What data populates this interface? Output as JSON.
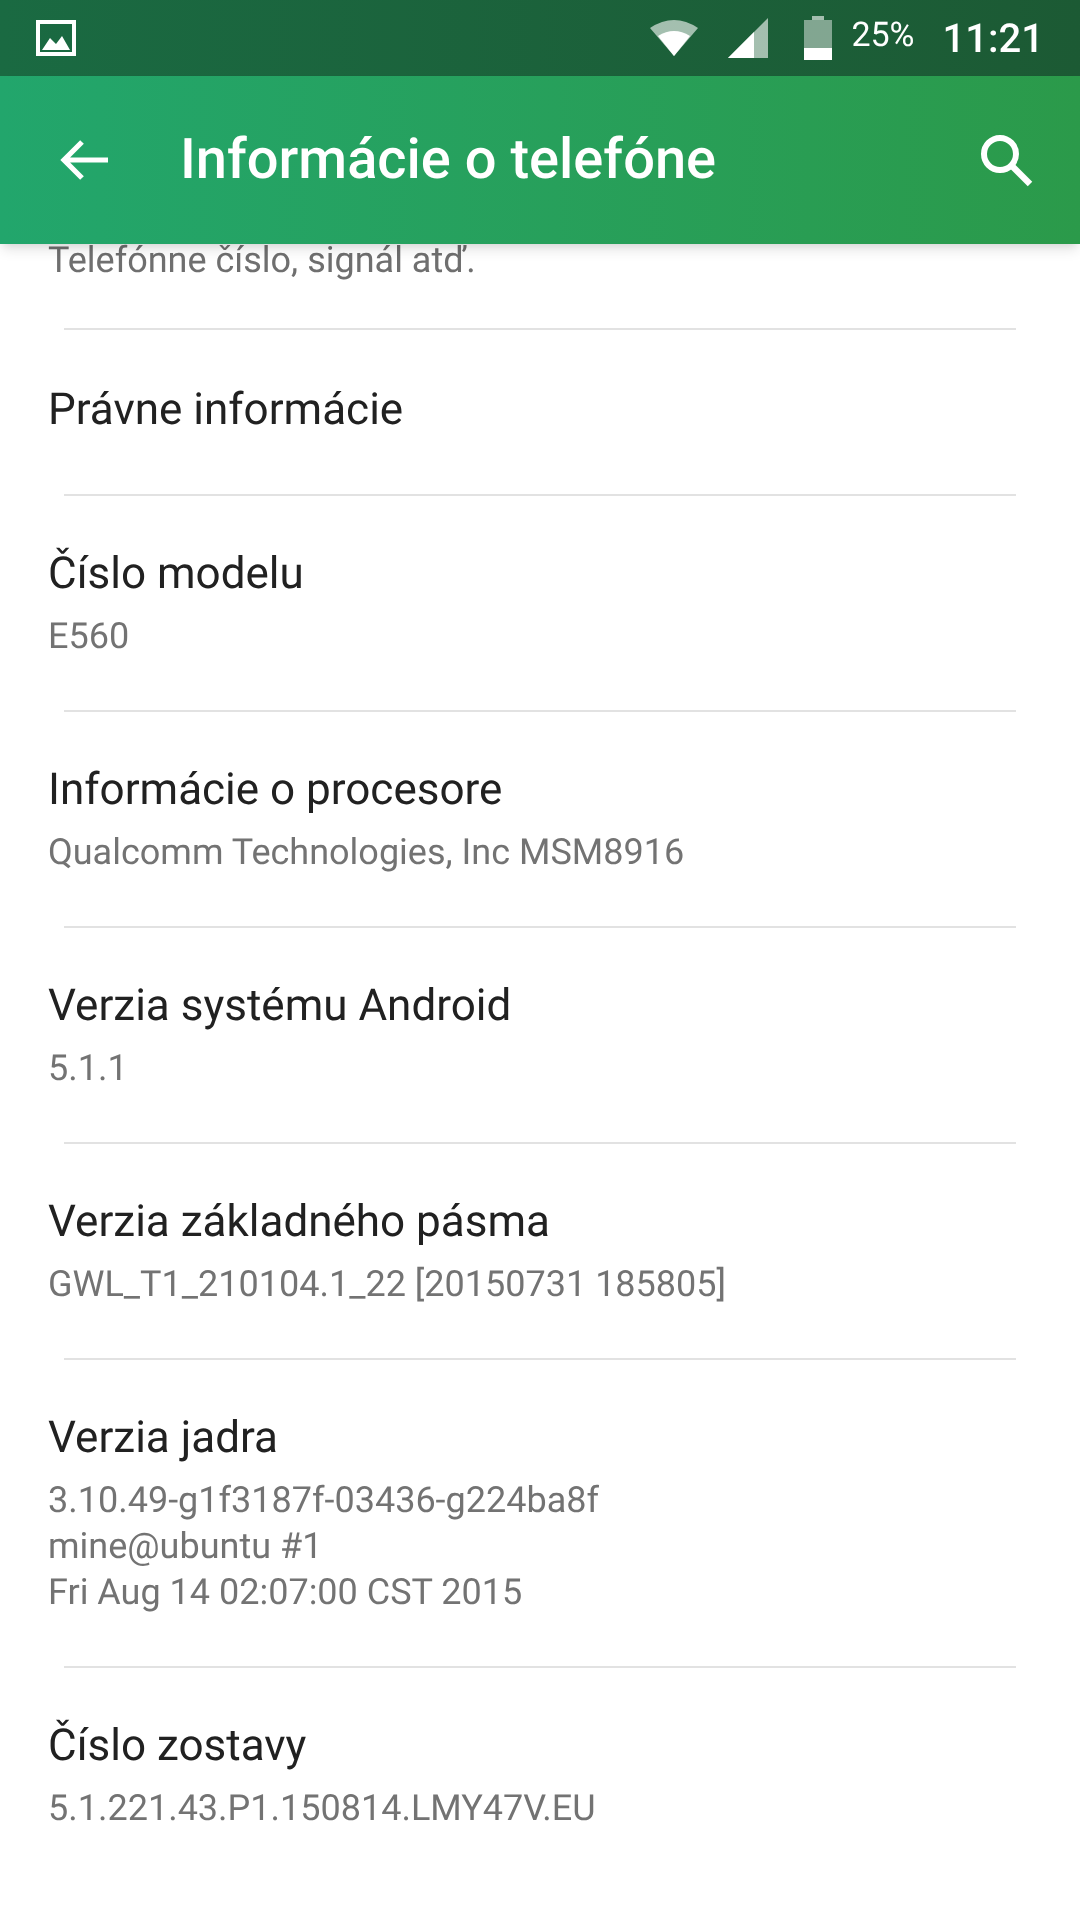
{
  "status_bar": {
    "battery": "25%",
    "time": "11:21"
  },
  "app_bar": {
    "title": "Informácie o telefóne"
  },
  "partial_item": {
    "subtitle": "Telefónne číslo, signál atď."
  },
  "items": [
    {
      "title": "Právne informácie"
    },
    {
      "title": "Číslo modelu",
      "value": "E560"
    },
    {
      "title": "Informácie o procesore",
      "value": "Qualcomm Technologies, Inc MSM8916"
    },
    {
      "title": "Verzia systému Android",
      "value": "5.1.1"
    },
    {
      "title": "Verzia základného pásma",
      "value": "GWL_T1_210104.1_22 [20150731 185805]"
    },
    {
      "title": "Verzia jadra",
      "value": "3.10.49-g1f3187f-03436-g224ba8f\nmine@ubuntu #1\nFri Aug 14 02:07:00 CST 2015"
    },
    {
      "title": "Číslo zostavy",
      "value": "5.1.221.43.P1.150814.LMY47V.EU"
    }
  ]
}
